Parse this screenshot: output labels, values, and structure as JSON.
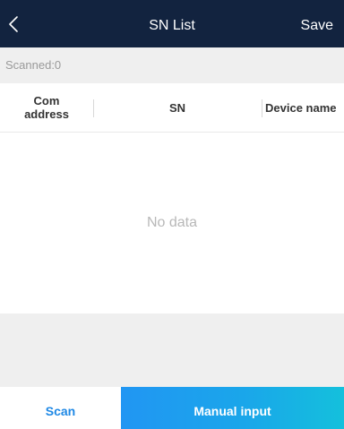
{
  "header": {
    "back_icon": "chevron-left-icon",
    "title": "SN List",
    "save_label": "Save"
  },
  "status": {
    "scanned_text": "Scanned:0"
  },
  "table": {
    "columns": [
      "Com address",
      "SN",
      "Device name"
    ],
    "rows": []
  },
  "empty_state": {
    "text": "No data"
  },
  "actions": {
    "scan_label": "Scan",
    "manual_input_label": "Manual input"
  },
  "colors": {
    "header_bg": "#12233f",
    "accent_blue": "#1e88e5",
    "gradient_start": "#2196f3",
    "gradient_end": "#14c0dc"
  }
}
